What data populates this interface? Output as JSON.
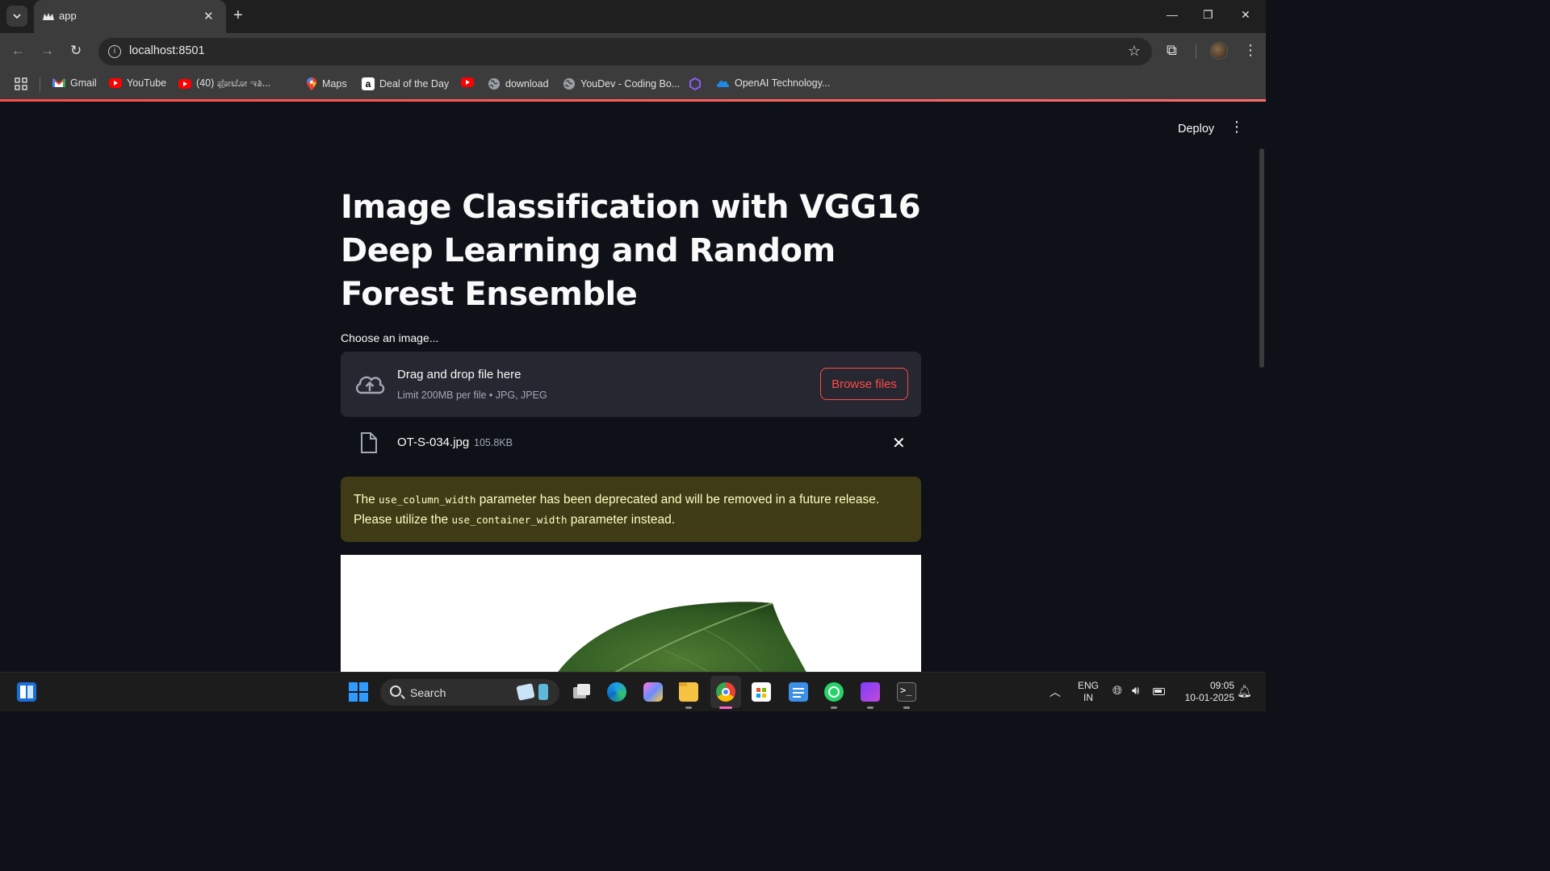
{
  "browser": {
    "tab": {
      "title": "app"
    },
    "url": "localhost:8501",
    "bookmarks": [
      {
        "label": "Gmail",
        "icon": "gmail-icon"
      },
      {
        "label": "YouTube",
        "icon": "youtube-icon"
      },
      {
        "label": "(40) ಫೋಟೋ ಇತಿ...",
        "icon": "youtube-icon"
      },
      {
        "label": "Maps",
        "icon": "maps-icon"
      },
      {
        "label": "Deal of the Day",
        "icon": "amazon-icon"
      },
      {
        "label": "",
        "icon": "youtube-icon"
      },
      {
        "label": "download",
        "icon": "globe-icon"
      },
      {
        "label": "YouDev - Coding Bo...",
        "icon": "globe-icon"
      },
      {
        "label": "",
        "icon": "hexagon-icon"
      },
      {
        "label": "OpenAI Technology...",
        "icon": "onedrive-icon"
      }
    ]
  },
  "app": {
    "deploy_label": "Deploy",
    "title": "Image Classification with VGG16 Deep Learning and Random Forest Ensemble",
    "uploader": {
      "label": "Choose an image...",
      "drop_text": "Drag and drop file here",
      "limit_text": "Limit 200MB per file • JPG, JPEG",
      "browse_label": "Browse files"
    },
    "file": {
      "name": "OT-S-034.jpg",
      "size": "105.8KB"
    },
    "warning": {
      "part1": "The ",
      "code1": "use_column_width",
      "part2": " parameter has been deprecated and will be removed in a future release. Please utilize the ",
      "code2": "use_container_width",
      "part3": " parameter instead."
    }
  },
  "taskbar": {
    "search_placeholder": "Search",
    "lang_line1": "ENG",
    "lang_line2": "IN",
    "time": "09:05",
    "date": "10-01-2025"
  },
  "colors": {
    "accent": "#ff4b4b",
    "background": "#0e1117",
    "dropzone": "#262730",
    "warning_bg": "#3e3b16",
    "warning_text": "#ffffc2"
  }
}
